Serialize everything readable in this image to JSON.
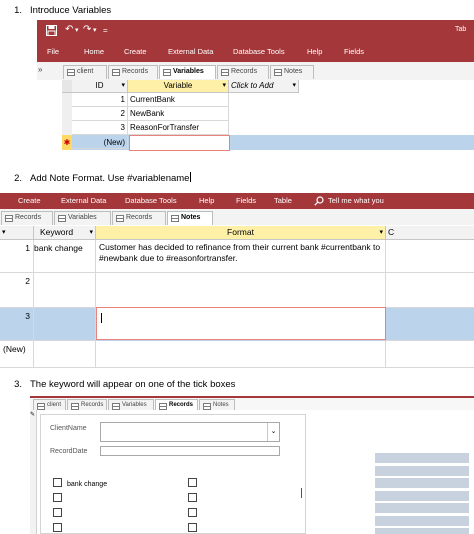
{
  "steps": [
    {
      "num": "1.",
      "text": "Introduce Variables"
    },
    {
      "num": "2.",
      "text": "Add Note Format. Use #variablename"
    },
    {
      "num": "3.",
      "text": "The keyword will appear on one of the tick boxes"
    }
  ],
  "window1": {
    "title_fragment": "Tab",
    "quick_access": {
      "save_icon": "save-icon",
      "undo_icon": "undo-icon",
      "redo_icon": "redo-icon",
      "customize_glyph": "="
    },
    "ribbon_tabs": [
      "File",
      "Home",
      "Create",
      "External Data",
      "Database Tools",
      "Help",
      "Fields"
    ],
    "nav_chevron": "»",
    "object_tabs": [
      "client",
      "Records",
      "Variables",
      "Records",
      "Notes"
    ],
    "active_tab": "Variables",
    "grid": {
      "headers": [
        "ID",
        "Variable",
        "Click to Add"
      ],
      "header_dropdown": "▾",
      "rows": [
        {
          "id": "1",
          "variable": "CurrentBank"
        },
        {
          "id": "2",
          "variable": "NewBank"
        },
        {
          "id": "3",
          "variable": "ReasonForTransfer"
        }
      ],
      "new_row_marker": "✱",
      "new_row_label": "(New)"
    }
  },
  "window2": {
    "ribbon_tabs": [
      "Create",
      "External Data",
      "Database Tools",
      "Help",
      "Fields",
      "Table"
    ],
    "tell_me": "Tell me what you",
    "object_tabs": [
      "Records",
      "Variables",
      "Records",
      "Notes"
    ],
    "active_tab": "Notes",
    "grid": {
      "headers": [
        "Keyword",
        "Format",
        "C"
      ],
      "rows": [
        {
          "id": "1",
          "keyword": "bank change",
          "format": "Customer has decided to refinance from their current bank #currentbank to #newbank due to #reasonfortransfer."
        },
        {
          "id": "2",
          "keyword": "",
          "format": ""
        },
        {
          "id": "3",
          "keyword": "",
          "format": ""
        }
      ],
      "new_row_label": "(New)"
    }
  },
  "window3": {
    "object_tabs": [
      "client",
      "Records",
      "Variables",
      "Records",
      "Notes"
    ],
    "active_tab": "Records",
    "form": {
      "client_label": "ClientName",
      "record_date_label": "RecordDate",
      "client_value": "",
      "record_date_value": "",
      "checkbox_label": "bank change"
    }
  },
  "colors": {
    "accent": "#a4373a",
    "selected_row": "#bcd3ec",
    "header_highlight": "#fff0a8",
    "focus_border": "#e8827a"
  }
}
